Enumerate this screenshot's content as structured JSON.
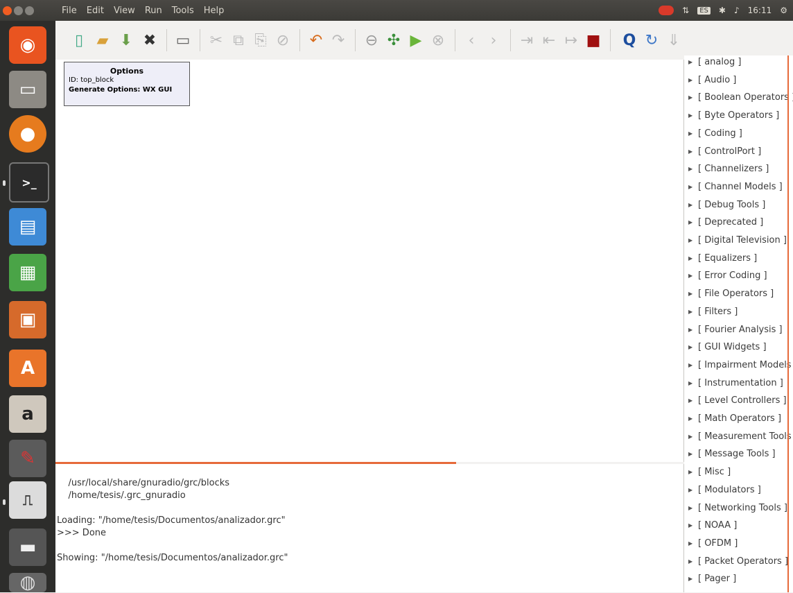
{
  "menubar": {
    "items": [
      "File",
      "Edit",
      "View",
      "Run",
      "Tools",
      "Help"
    ]
  },
  "indicators": {
    "keyboard": "ES",
    "clock": "16:11"
  },
  "launcher": {
    "icons": [
      "ubuntu-dash-icon",
      "files-icon",
      "firefox-icon",
      "terminal-icon",
      "writer-icon",
      "calc-icon",
      "impress-icon",
      "software-center-icon",
      "amazon-icon",
      "system-settings-icon",
      "gnuradio-companion-icon",
      "save-device-icon",
      "misc-icon"
    ]
  },
  "toolbar": {
    "icons": [
      "new-icon",
      "open-icon",
      "save-icon",
      "close-icon",
      "screenshot-icon",
      "cut-icon",
      "copy-icon",
      "paste-icon",
      "delete-icon",
      "undo-icon",
      "redo-icon",
      "disable-icon",
      "generate-icon",
      "execute-icon",
      "kill-icon",
      "rotate-left-icon",
      "rotate-right-icon",
      "enable-icon",
      "bypass-icon",
      "stop-icon",
      "find-icon",
      "reload-icon",
      "help-icon"
    ]
  },
  "options_block": {
    "title": "Options",
    "id_line": "ID: top_block",
    "generate_line": "Generate Options: WX GUI"
  },
  "console": {
    "lines": [
      "    /usr/local/share/gnuradio/grc/blocks",
      "    /home/tesis/.grc_gnuradio",
      "",
      "Loading: \"/home/tesis/Documentos/analizador.grc\"",
      ">>> Done",
      "",
      "Showing: \"/home/tesis/Documentos/analizador.grc\""
    ]
  },
  "blocklist": {
    "categories": [
      "[ analog ]",
      "[ Audio ]",
      "[ Boolean Operators ]",
      "[ Byte Operators ]",
      "[ Coding ]",
      "[ ControlPort ]",
      "[ Channelizers ]",
      "[ Channel Models ]",
      "[ Debug Tools ]",
      "[ Deprecated ]",
      "[ Digital Television ]",
      "[ Equalizers ]",
      "[ Error Coding ]",
      "[ File Operators ]",
      "[ Filters ]",
      "[ Fourier Analysis ]",
      "[ GUI Widgets ]",
      "[ Impairment Models ]",
      "[ Instrumentation ]",
      "[ Level Controllers ]",
      "[ Math Operators ]",
      "[ Measurement Tools ]",
      "[ Message Tools ]",
      "[ Misc ]",
      "[ Modulators ]",
      "[ Networking Tools ]",
      "[ NOAA ]",
      "[ OFDM ]",
      "[ Packet Operators ]",
      "[ Pager ]"
    ]
  },
  "colors": {
    "accent": "#e66a3a",
    "launcher_bg": "#2d2d2b",
    "topbar_bg": "#3b3a36"
  }
}
